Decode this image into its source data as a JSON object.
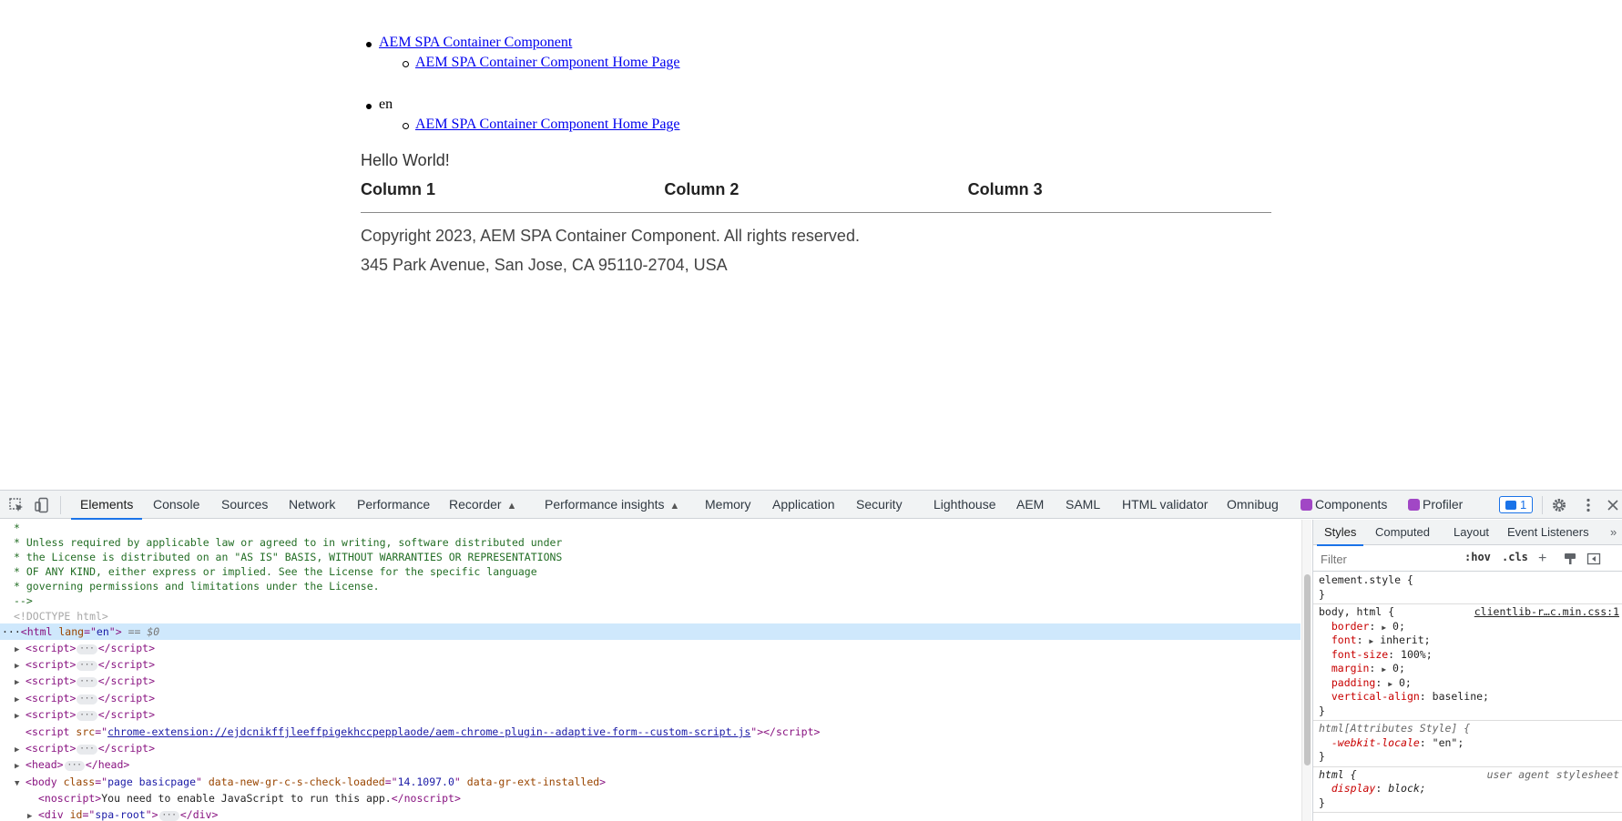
{
  "page": {
    "nav": [
      {
        "label": "AEM SPA Container Component",
        "is_link": true,
        "children": [
          {
            "label": "AEM SPA Container Component Home Page"
          }
        ]
      },
      {
        "label": "en",
        "is_link": false,
        "children": [
          {
            "label": "AEM SPA Container Component Home Page"
          }
        ]
      }
    ],
    "hello": "Hello World!",
    "columns": [
      "Column 1",
      "Column 2",
      "Column 3"
    ],
    "copyright": "Copyright 2023, AEM SPA Container Component. All rights reserved.",
    "address": "345 Park Avenue, San Jose, CA 95110-2704, USA"
  },
  "devtools": {
    "tabs": [
      "Elements",
      "Console",
      "Sources",
      "Network",
      "Performance",
      "Recorder",
      "Performance insights",
      "Memory",
      "Application",
      "Security",
      "Lighthouse",
      "AEM",
      "SAML",
      "HTML validator",
      "Omnibug",
      "Components",
      "Profiler"
    ],
    "active_tab": "Elements",
    "issues_count": "1",
    "elements": {
      "comment_lines": [
        "*",
        "* Unless required by applicable law or agreed to in writing, software distributed under",
        "* the License is distributed on an \"AS IS\" BASIS, WITHOUT WARRANTIES OR REPRESENTATIONS",
        "* OF ANY KIND, either express or implied. See the License for the specific language",
        "* governing permissions and limitations under the License.",
        "-->"
      ],
      "doctype": "<!DOCTYPE html>",
      "html_tag": "html",
      "html_lang_attr": "lang",
      "html_lang_val": "en",
      "selected_suffix": "== $0",
      "script_tag": "script",
      "script_src_attr": "src",
      "script_src": "chrome-extension://ejdcnikffjleeffpigekhccpepplaode/aem-chrome-plugin--adaptive-form--custom-script.js",
      "head_tag": "head",
      "body_tag": "body",
      "body_class": "page basicpage",
      "body_attr2": "data-new-gr-c-s-check-loaded",
      "body_attr2_val": "14.1097.0",
      "body_attr3": "data-gr-ext-installed",
      "noscript_text": "You need to enable JavaScript to run this app.",
      "div_id": "spa-root"
    },
    "styles": {
      "sub_tabs": [
        "Styles",
        "Computed",
        "Layout",
        "Event Listeners"
      ],
      "active_sub_tab": "Styles",
      "filter_placeholder": "Filter",
      "hov": ":hov",
      "cls": ".cls",
      "rules": [
        {
          "selector": "element.style {",
          "source": "",
          "props": []
        },
        {
          "selector": "body, html {",
          "source": "clientlib-r…c.min.css:1",
          "props": [
            [
              "border",
              "0;",
              true
            ],
            [
              "font",
              "inherit;",
              true
            ],
            [
              "font-size",
              "100%;",
              false
            ],
            [
              "margin",
              "0;",
              true
            ],
            [
              "padding",
              "0;",
              true
            ],
            [
              "vertical-align",
              "baseline;",
              false
            ]
          ]
        },
        {
          "selector": "html[Attributes Style] {",
          "source": "",
          "props": [
            [
              "-webkit-locale",
              "\"en\";",
              false
            ]
          ]
        },
        {
          "selector": "html {",
          "source": "user agent stylesheet",
          "props": [
            [
              "display",
              "block;",
              false
            ]
          ]
        }
      ]
    }
  }
}
